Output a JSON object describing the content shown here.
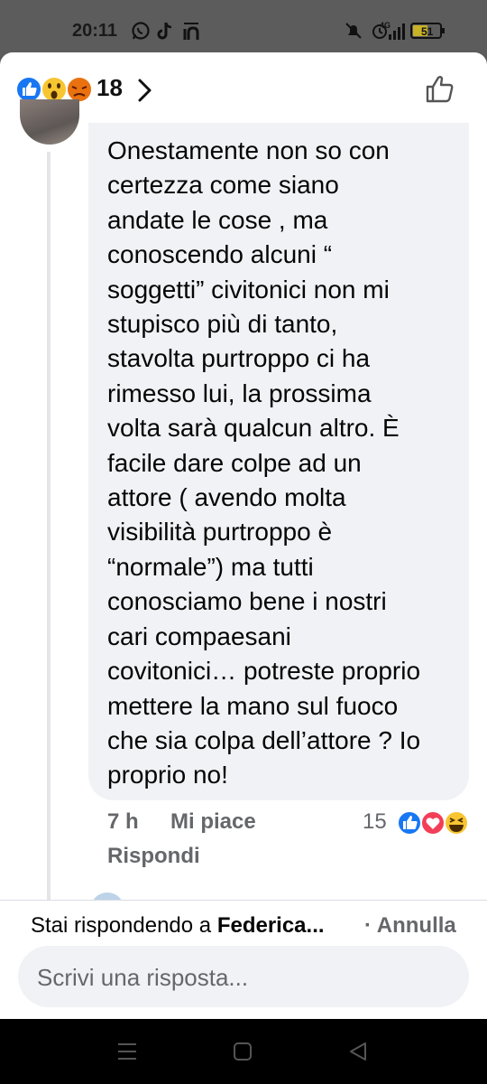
{
  "status_bar": {
    "time": "20:11",
    "icons": [
      "whatsapp-icon",
      "tiktok-icon",
      "app-icon",
      "mute-icon",
      "alarm-icon",
      "signal-icon"
    ],
    "network": "4G",
    "battery": "51"
  },
  "reactions": {
    "types": [
      "like",
      "wow",
      "angry"
    ],
    "count": "18"
  },
  "comment": {
    "lines": [
      "Onestamente non so con",
      "certezza come siano",
      "andate le cose , ma",
      "conoscendo alcuni “",
      "soggetti” civitonici non mi",
      "stupisco più di tanto,",
      "stavolta purtroppo ci ha",
      "rimesso lui, la prossima",
      "volta sarà qualcun altro. È",
      "facile dare colpe ad un",
      "attore ( avendo molta",
      "visibilità purtroppo è",
      "“normale”) ma tutti",
      "conosciamo bene i nostri",
      "cari compaesani",
      "covitonici… potreste proprio",
      "mettere la mano sul fuoco",
      "che sia colpa dell’attore ? Io",
      "proprio no!"
    ],
    "time": "7 h",
    "like_label": "Mi piace",
    "reply_label": "Rispondi",
    "reaction_count": "15",
    "reaction_types": [
      "like",
      "love",
      "haha"
    ]
  },
  "reply_bar": {
    "replying_prefix": "Stai rispondendo a ",
    "replying_name": "Federica...",
    "cancel_label": "· Annulla",
    "placeholder": "Scrivi una risposta..."
  },
  "colors": {
    "facebook_blue": "#1877f2",
    "bubble_gray": "#f0f2f5",
    "meta_gray": "#65676b"
  }
}
